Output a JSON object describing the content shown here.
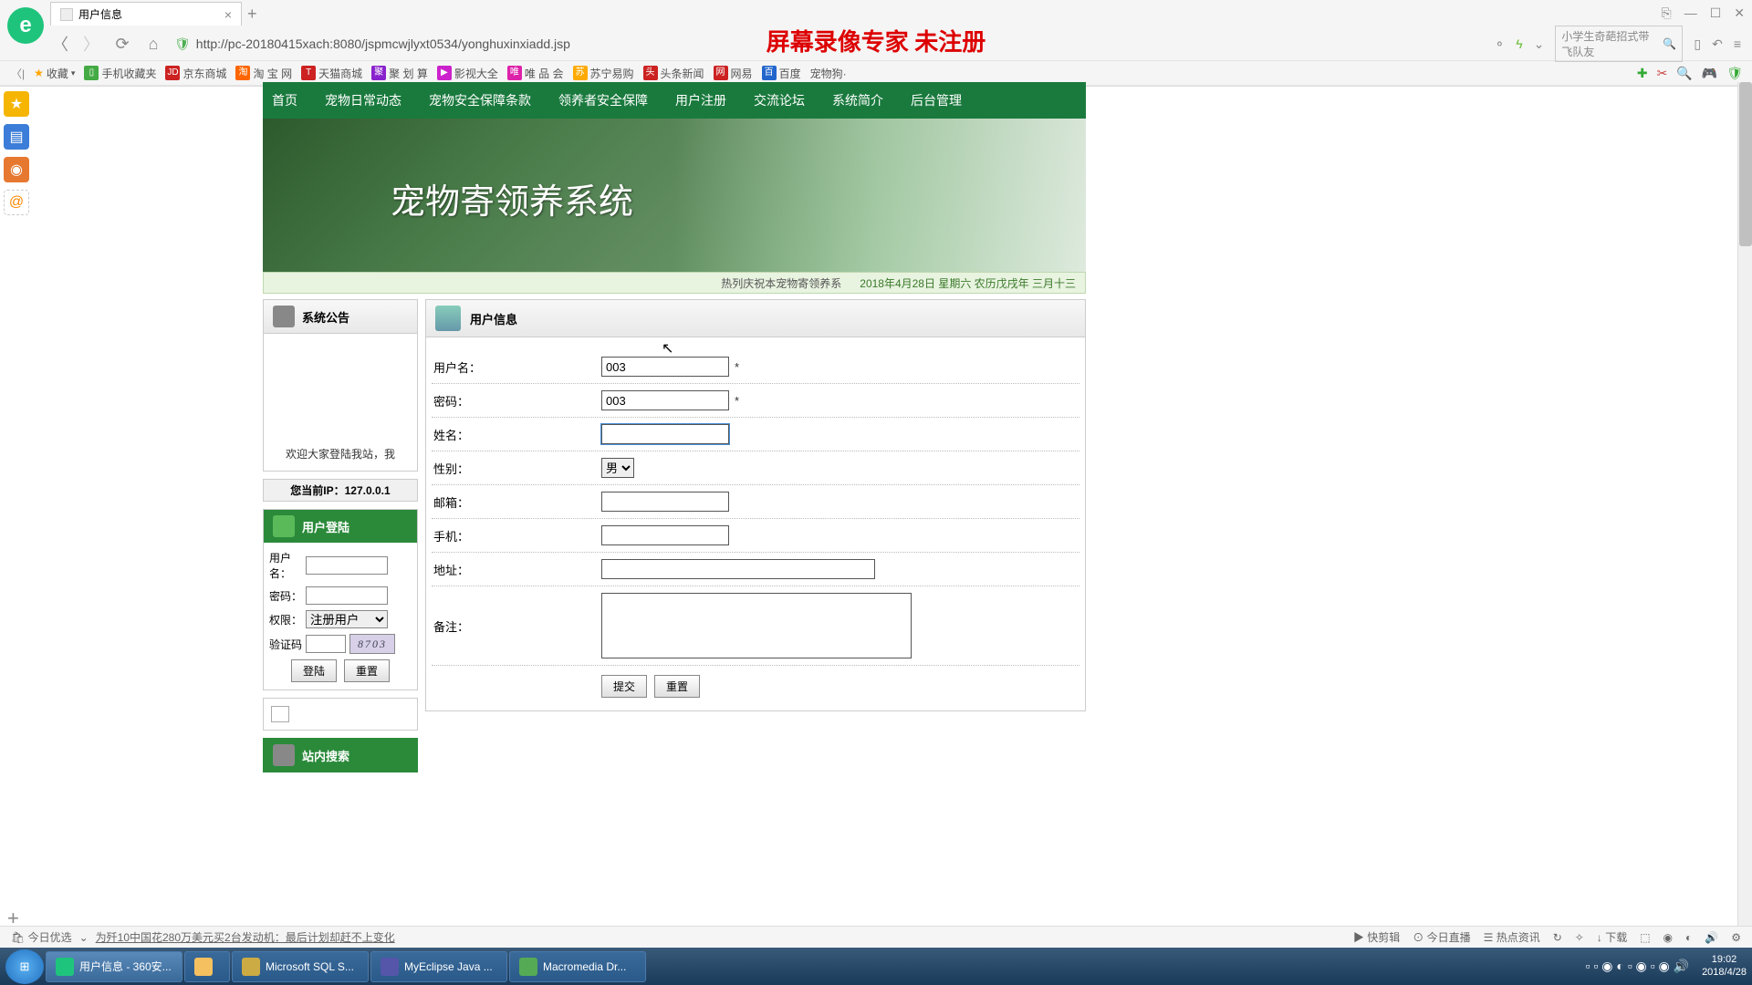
{
  "browser": {
    "tab_title": "用户信息",
    "url": "http://pc-20180415xach:8080/jspmcwjlyxt0534/yonghuxinxiadd.jsp",
    "search_placeholder": "小学生奇葩招式带飞队友"
  },
  "watermark": "屏幕录像专家  未注册",
  "bookmarks": {
    "fav": "收藏",
    "items": [
      "手机收藏夹",
      "京东商城",
      "淘 宝 网",
      "天猫商城",
      "聚 划 算",
      "影视大全",
      "唯 品 会",
      "苏宁易购",
      "头条新闻",
      "网易",
      "百度",
      "宠物狗·"
    ]
  },
  "nav": [
    "首页",
    "宠物日常动态",
    "宠物安全保障条款",
    "领养者安全保障",
    "用户注册",
    "交流论坛",
    "系统简介",
    "后台管理"
  ],
  "banner_title": "宠物寄领养系统",
  "ticker": {
    "msg": "热列庆祝本宠物寄领养系",
    "date": "2018年4月28日  星期六  农历戊戌年  三月十三"
  },
  "sidebar": {
    "announce_title": "系统公告",
    "announce_text": "欢迎大家登陆我站，我",
    "ip_label": "您当前IP：127.0.0.1",
    "login_title": "用户登陆",
    "login": {
      "user_label": "用户名：",
      "pwd_label": "密码：",
      "role_label": "权限：",
      "role_value": "注册用户",
      "captcha_label": "验证码",
      "captcha_value": "8703",
      "login_btn": "登陆",
      "reset_btn": "重置"
    },
    "search_title": "站内搜索"
  },
  "form": {
    "title": "用户信息",
    "fields": {
      "username_label": "用户名：",
      "username_value": "003",
      "password_label": "密码：",
      "password_value": "003",
      "name_label": "姓名：",
      "gender_label": "性别：",
      "gender_value": "男",
      "email_label": "邮箱：",
      "phone_label": "手机：",
      "address_label": "地址：",
      "remark_label": "备注："
    },
    "required_mark": "*",
    "submit": "提交",
    "reset": "重置"
  },
  "statusbar": {
    "today": "今日优选",
    "news": "为歼10中国花280万美元买2台发动机：最后计划却赶不上变化",
    "items": [
      "快剪辑",
      "今日直播",
      "热点资讯",
      "下载"
    ]
  },
  "taskbar": {
    "items": [
      "用户信息 - 360安...",
      "",
      "Microsoft SQL S...",
      "MyEclipse Java ...",
      "Macromedia Dr..."
    ],
    "time": "19:02",
    "date": "2018/4/28"
  }
}
